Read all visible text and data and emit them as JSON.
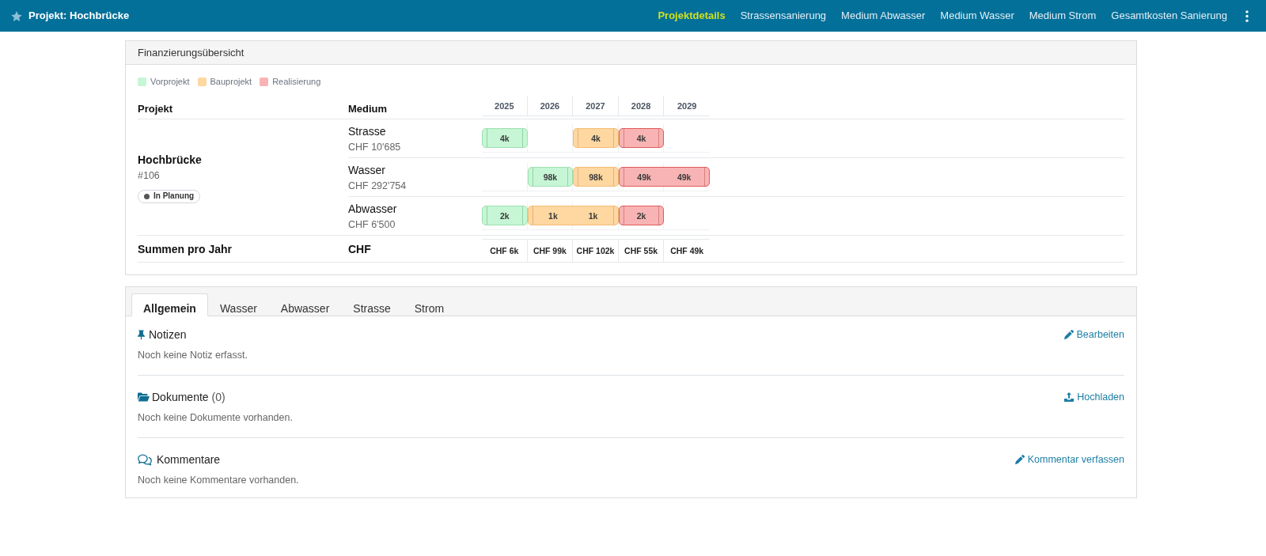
{
  "header": {
    "title": "Projekt: Hochbrücke",
    "nav": [
      {
        "label": "Projektdetails",
        "selected": true
      },
      {
        "label": "Strassensanierung",
        "selected": false
      },
      {
        "label": "Medium Abwasser",
        "selected": false
      },
      {
        "label": "Medium Wasser",
        "selected": false
      },
      {
        "label": "Medium Strom",
        "selected": false
      },
      {
        "label": "Gesamtkosten Sanierung",
        "selected": false
      }
    ]
  },
  "financing": {
    "title": "Finanzierungsübersicht",
    "legend": [
      {
        "kind": "vorprojekt",
        "label": "Vorprojekt",
        "color": "#c6f6d5"
      },
      {
        "kind": "bauprojekt",
        "label": "Bauprojekt",
        "color": "#fed7a1"
      },
      {
        "kind": "realisierung",
        "label": "Realisierung",
        "color": "#f8b4b4"
      }
    ],
    "columns": {
      "project": "Projekt",
      "medium": "Medium",
      "years": [
        "2025",
        "2026",
        "2027",
        "2028",
        "2029"
      ]
    },
    "project": {
      "name": "Hochbrücke",
      "number": "#106",
      "status": "In Planung"
    },
    "rows": [
      {
        "medium": "Strasse",
        "amount": "CHF 10'685",
        "cells": [
          {
            "kind": "vorprojekt",
            "label": "4k"
          },
          {
            "kind": "empty"
          },
          {
            "kind": "bauprojekt",
            "label": "4k"
          },
          {
            "kind": "realisierung",
            "label": "4k"
          },
          {
            "kind": "empty"
          }
        ]
      },
      {
        "medium": "Wasser",
        "amount": "CHF 292'754",
        "cells": [
          {
            "kind": "empty"
          },
          {
            "kind": "vorprojekt",
            "label": "98k"
          },
          {
            "kind": "bauprojekt",
            "label": "98k"
          },
          {
            "kind": "realisierung",
            "label": "49k"
          },
          {
            "kind": "realisierung",
            "label": "49k"
          }
        ]
      },
      {
        "medium": "Abwasser",
        "amount": "CHF 6'500",
        "cells": [
          {
            "kind": "vorprojekt",
            "label": "2k"
          },
          {
            "kind": "bauprojekt",
            "label": "1k"
          },
          {
            "kind": "bauprojekt",
            "label": "1k"
          },
          {
            "kind": "realisierung",
            "label": "2k"
          },
          {
            "kind": "empty"
          }
        ]
      }
    ],
    "totals": {
      "label": "Summen pro Jahr",
      "currency": "CHF",
      "values": [
        "CHF 6k",
        "CHF 99k",
        "CHF 102k",
        "CHF 55k",
        "CHF 49k"
      ]
    }
  },
  "details": {
    "tabs": [
      {
        "label": "Allgemein",
        "selected": true
      },
      {
        "label": "Wasser",
        "selected": false
      },
      {
        "label": "Abwasser",
        "selected": false
      },
      {
        "label": "Strasse",
        "selected": false
      },
      {
        "label": "Strom",
        "selected": false
      }
    ],
    "sections": [
      {
        "kind": "notes",
        "title": "Notizen",
        "message": "Noch keine Notiz erfasst.",
        "action": "Bearbeiten"
      },
      {
        "kind": "documents",
        "title": "Dokumente",
        "count": "(0)",
        "message": "Noch keine Dokumente vorhanden.",
        "action": "Hochladen"
      },
      {
        "kind": "comments",
        "title": "Kommentare",
        "message": "Noch keine Kommentare vorhanden.",
        "action": "Kommentar verfassen"
      }
    ]
  }
}
